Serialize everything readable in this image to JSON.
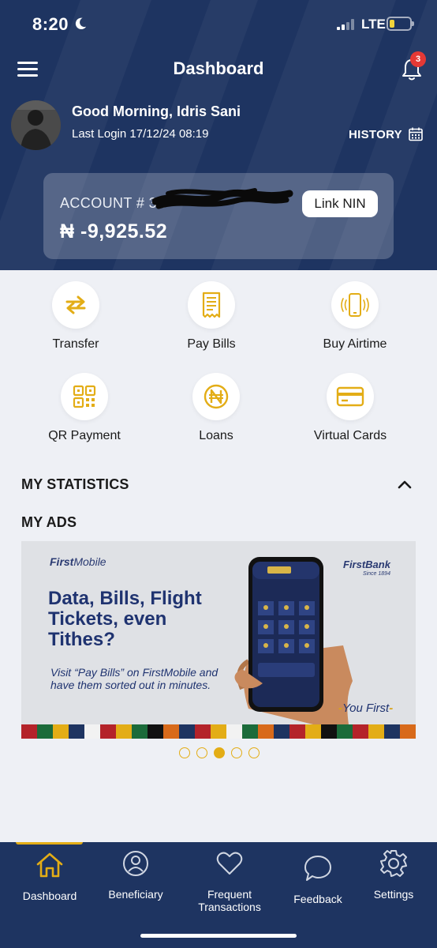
{
  "status_bar": {
    "time": "8:20",
    "network": "LTE",
    "battery_color": "#f1d33a"
  },
  "header": {
    "title": "Dashboard",
    "notification_count": "3",
    "greeting": "Good Morning, Idris Sani",
    "last_login": "Last Login 17/12/24 08:19",
    "history_label": "HISTORY"
  },
  "account": {
    "label_prefix": "ACCOUNT # 31",
    "number_redacted": true,
    "balance": "₦ -9,925.52",
    "link_nin_label": "Link NIN"
  },
  "quick_actions": [
    {
      "label": "Transfer",
      "icon": "transfer-arrows-icon"
    },
    {
      "label": "Pay Bills",
      "icon": "receipt-icon"
    },
    {
      "label": "Buy Airtime",
      "icon": "phone-ringing-icon"
    },
    {
      "label": "QR Payment",
      "icon": "qr-code-icon"
    },
    {
      "label": "Loans",
      "icon": "naira-coin-icon"
    },
    {
      "label": "Virtual Cards",
      "icon": "credit-card-icon"
    }
  ],
  "sections": {
    "statistics": "MY STATISTICS",
    "ads": "MY ADS"
  },
  "ad": {
    "brand_first": "First",
    "brand_second": "Mobile",
    "bank_name": "FirstBank",
    "bank_since": "Since 1894",
    "headline": "Data, Bills, Flight Tickets, even Tithes?",
    "body": "Visit “Pay Bills” on FirstMobile and have them sorted out in minutes.",
    "tagline": "You First",
    "slide_count": 5,
    "active_slide": 3
  },
  "bottom_nav": [
    {
      "label": "Dashboard",
      "icon": "home-icon",
      "active": true
    },
    {
      "label": "Beneficiary",
      "icon": "user-icon",
      "active": false
    },
    {
      "label": "Frequent Transactions",
      "icon": "heart-icon",
      "active": false
    },
    {
      "label": "Feedback",
      "icon": "chat-bubble-icon",
      "active": false
    },
    {
      "label": "Settings",
      "icon": "gear-icon",
      "active": false
    }
  ],
  "colors": {
    "primary": "#1e3461",
    "accent": "#e3ad16",
    "background": "#eef0f5",
    "badge": "#e53935"
  }
}
